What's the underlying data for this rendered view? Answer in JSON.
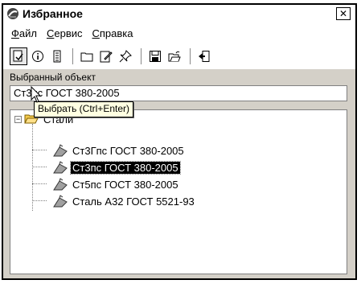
{
  "window": {
    "title": "Избранное",
    "close_label": "✕"
  },
  "menu": {
    "items": [
      {
        "ul": "Ф",
        "rest": "айл"
      },
      {
        "ul": "С",
        "rest": "ервис"
      },
      {
        "ul": "С",
        "rest": "правка"
      }
    ]
  },
  "toolbar": {
    "buttons": [
      "select-icon",
      "info-icon",
      "properties-icon",
      "folder-icon",
      "edit-icon",
      "pin-icon",
      "save-icon",
      "open-icon",
      "exit-icon"
    ]
  },
  "selection": {
    "label": "Выбранный объект",
    "value": "Ст3пс ГОСТ 380-2005"
  },
  "tooltip": {
    "text": "Выбрать (Ctrl+Enter)"
  },
  "tree": {
    "root": "Стали",
    "items": [
      "Ст3Гпс ГОСТ 380-2005",
      "Ст3пс ГОСТ 380-2005",
      "Ст5пс ГОСТ 380-2005",
      "Сталь А32 ГОСТ 5521-93"
    ],
    "selected_index": 1
  },
  "colors": {
    "tooltip_bg": "#ffffe1",
    "selection_bg": "#000000",
    "folder": "#f2c94c"
  }
}
